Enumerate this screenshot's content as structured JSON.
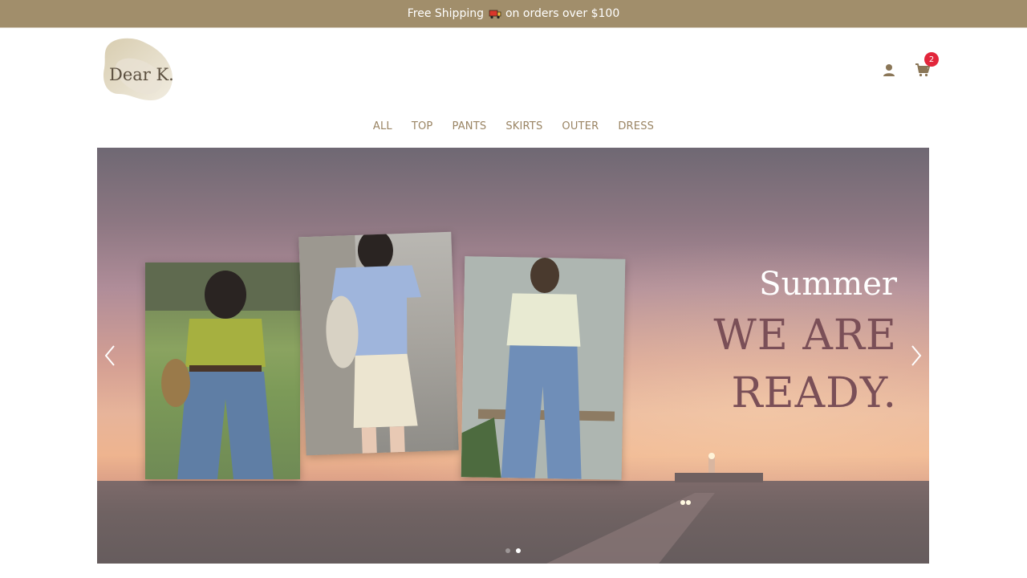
{
  "announcement": {
    "text_before": "Free Shipping",
    "text_after": "on orders over $100",
    "icon": "truck-icon"
  },
  "brand": {
    "logo_text": "Dear K."
  },
  "header": {
    "icons": [
      "user-icon",
      "cart-icon"
    ],
    "cart_count": "2"
  },
  "nav": {
    "items": [
      "ALL",
      "TOP",
      "PANTS",
      "SKIRTS",
      "OUTER",
      "DRESS"
    ]
  },
  "hero": {
    "title_small": "Summer",
    "title_line1": "WE ARE",
    "title_line2": "READY.",
    "slide_count": 2,
    "active_slide": 2,
    "controls": [
      "chevron-left-icon",
      "chevron-right-icon"
    ]
  },
  "colors": {
    "announcement_bg": "#a18e6b",
    "accent": "#8a7657",
    "badge": "#e2263b",
    "hero_title_dark": "#7a4f57"
  }
}
